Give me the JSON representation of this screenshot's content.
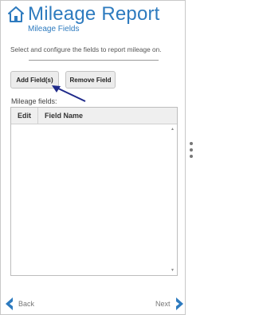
{
  "header": {
    "title": "Mileage Report",
    "subtitle": "Mileage Fields",
    "icon": "home-icon"
  },
  "instructions": "Select and configure the fields to report mileage on.",
  "buttons": {
    "add": "Add Field(s)",
    "remove": "Remove Field"
  },
  "fields": {
    "label": "Mileage fields:",
    "columns": [
      "Edit",
      "Field Name"
    ],
    "rows": []
  },
  "nav": {
    "back": "Back",
    "next": "Next"
  },
  "colors": {
    "accent": "#2e7bbf",
    "annotation_arrow": "#1f2a8a"
  }
}
